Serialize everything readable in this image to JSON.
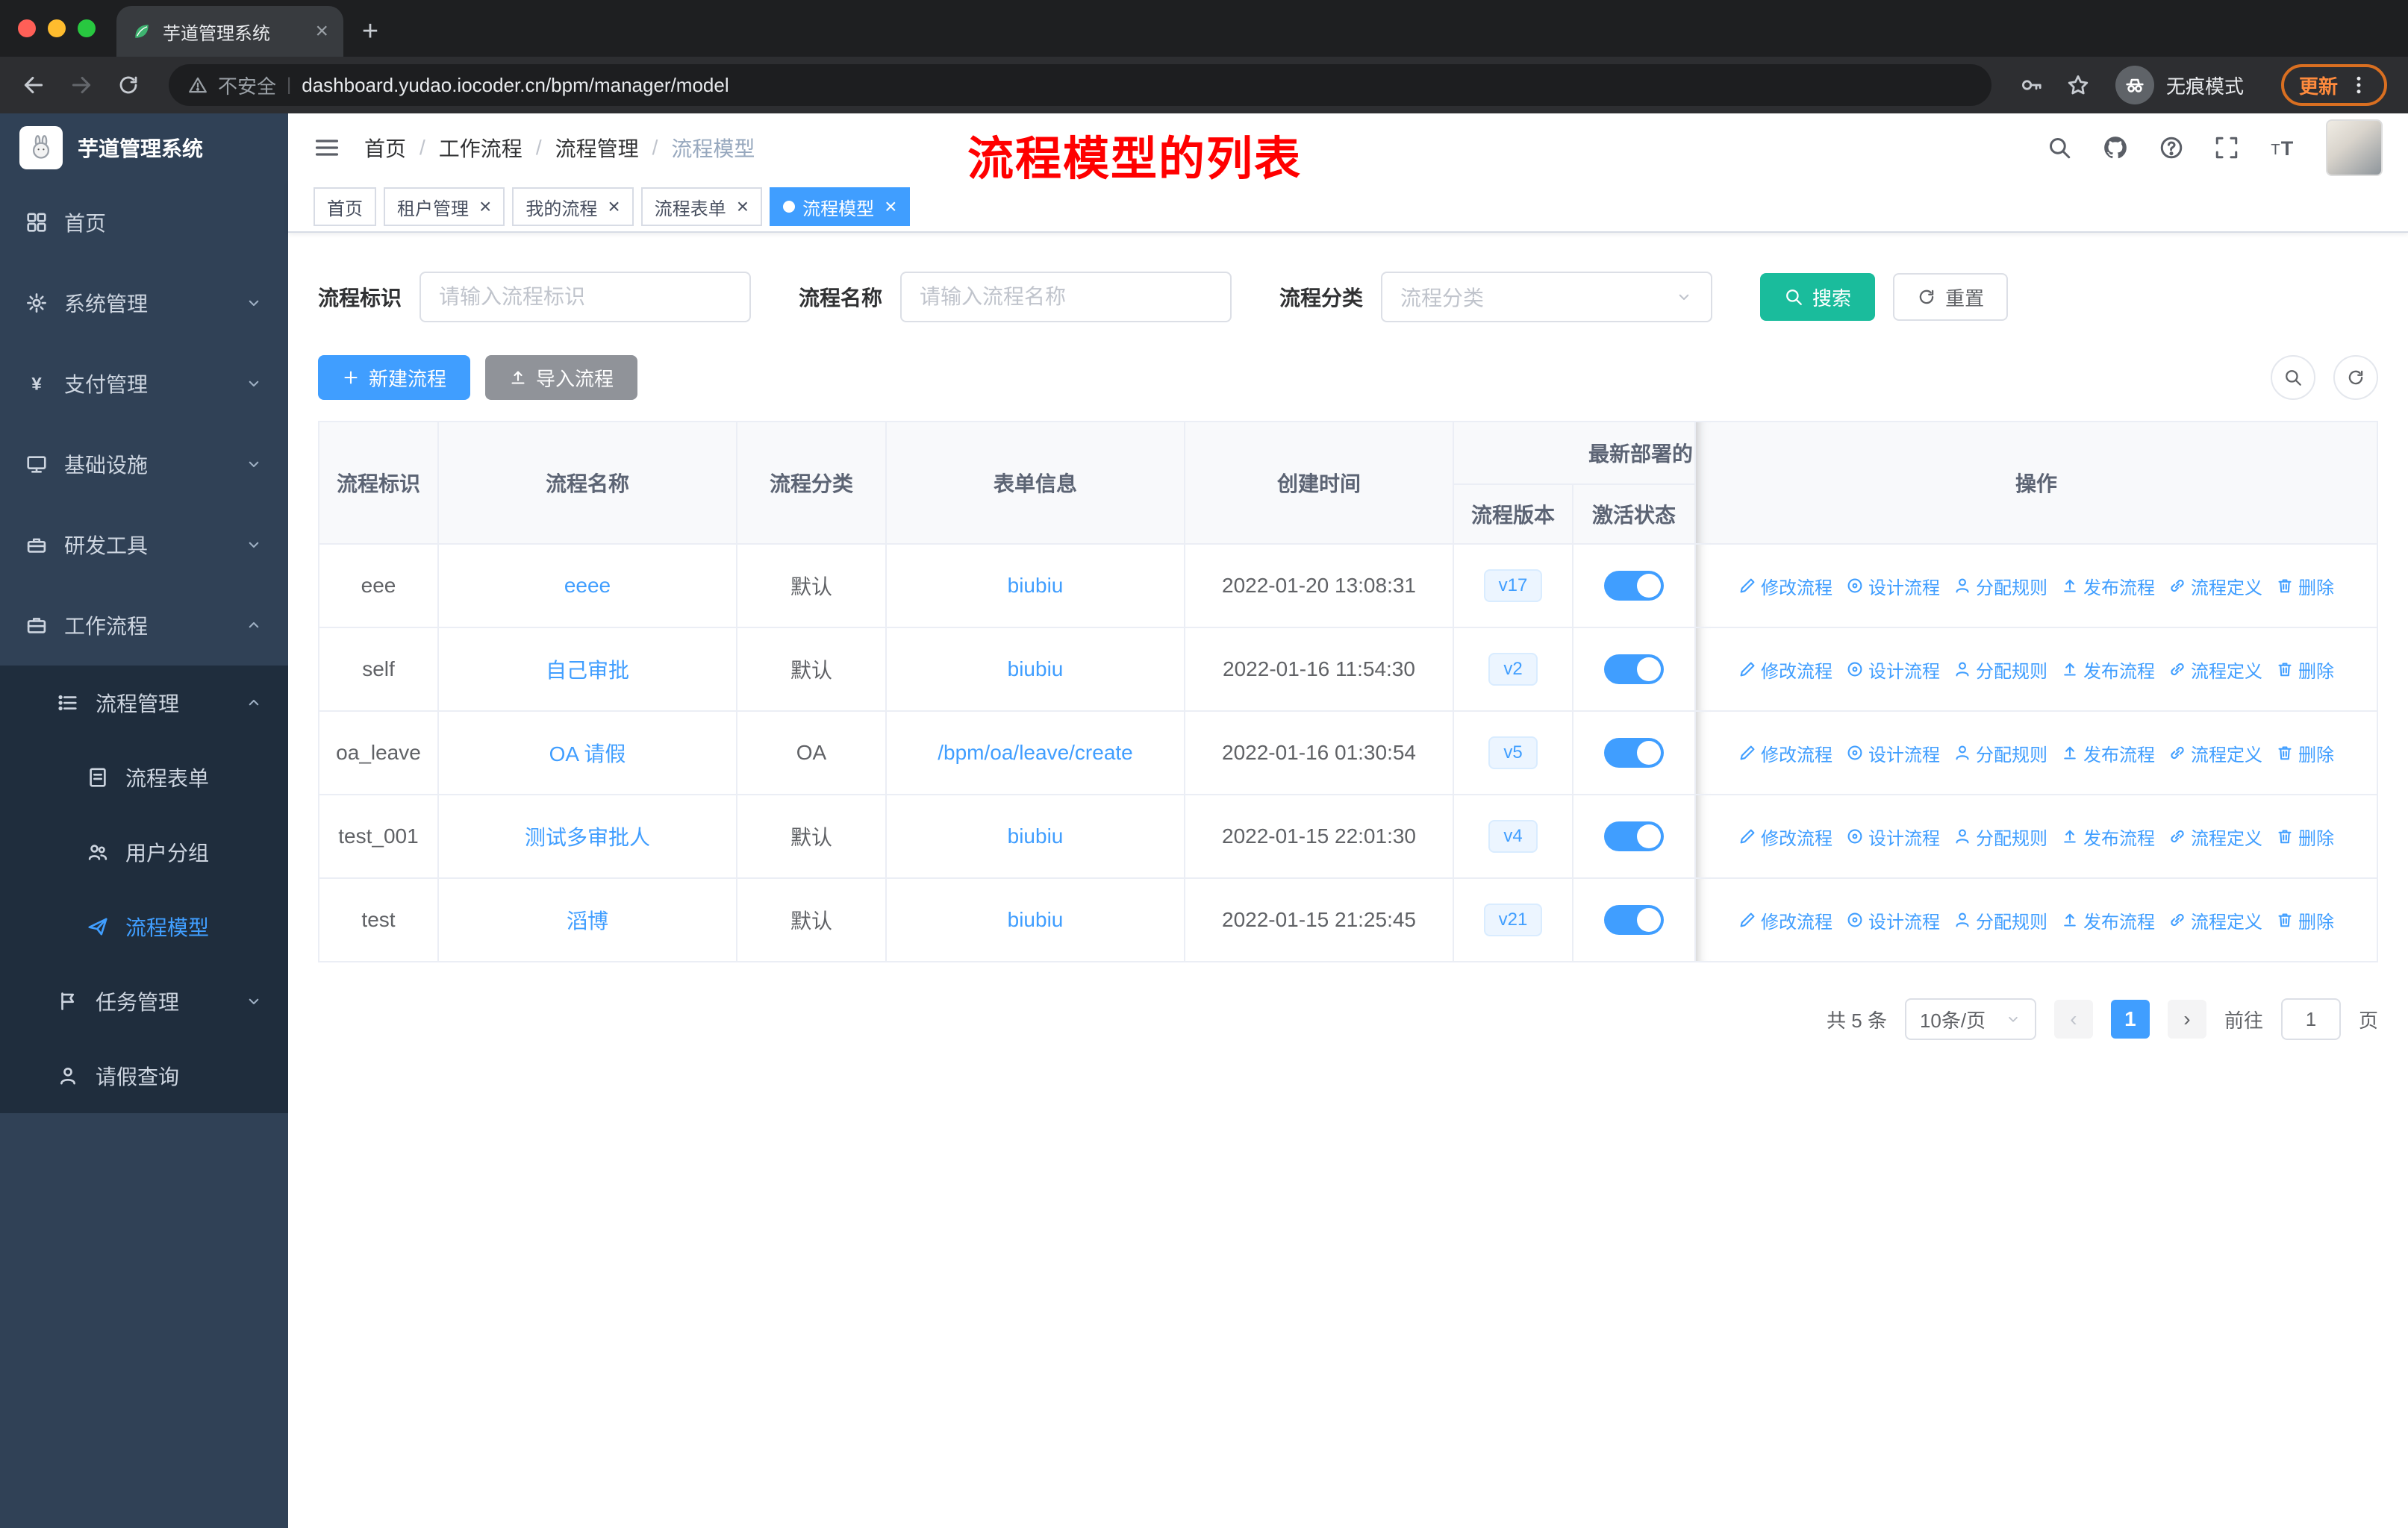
{
  "browser": {
    "tab_title": "芋道管理系统",
    "security_label": "不安全",
    "url": "dashboard.yudao.iocoder.cn/bpm/manager/model",
    "incognito_label": "无痕模式",
    "update_label": "更新"
  },
  "sidebar": {
    "logo_title": "芋道管理系统",
    "items": [
      {
        "key": "home",
        "label": "首页",
        "icon": "dashboard-icon",
        "level": 1
      },
      {
        "key": "system-manage",
        "label": "系统管理",
        "icon": "gear-icon",
        "level": 1,
        "chevron": "down"
      },
      {
        "key": "payment-manage",
        "label": "支付管理",
        "icon": "yen-icon",
        "level": 1,
        "chevron": "down"
      },
      {
        "key": "infrastructure",
        "label": "基础设施",
        "icon": "monitor-icon",
        "level": 1,
        "chevron": "down"
      },
      {
        "key": "dev-tools",
        "label": "研发工具",
        "icon": "toolbox-icon",
        "level": 1,
        "chevron": "down"
      },
      {
        "key": "workflow",
        "label": "工作流程",
        "icon": "briefcase-icon",
        "level": 1,
        "chevron": "up"
      },
      {
        "key": "process-manage",
        "label": "流程管理",
        "icon": "list-icon",
        "level": 2,
        "chevron": "up",
        "dark": true
      },
      {
        "key": "process-form",
        "label": "流程表单",
        "icon": "document-icon",
        "level": 3,
        "dark": true
      },
      {
        "key": "user-group",
        "label": "用户分组",
        "icon": "user-group-icon",
        "level": 3,
        "dark": true
      },
      {
        "key": "process-model",
        "label": "流程模型",
        "icon": "paper-plane-icon",
        "level": 3,
        "dark": true,
        "active": true
      },
      {
        "key": "task-manage",
        "label": "任务管理",
        "icon": "flag-icon",
        "level": 2,
        "chevron": "down",
        "dark": true
      },
      {
        "key": "leave-query",
        "label": "请假查询",
        "icon": "person-icon",
        "level": 2,
        "dark": true
      }
    ]
  },
  "header": {
    "breadcrumb": [
      "首页",
      "工作流程",
      "流程管理",
      "流程模型"
    ],
    "annotation": "流程模型的列表"
  },
  "tags": [
    {
      "key": "home",
      "label": "首页",
      "closable": false,
      "active": false
    },
    {
      "key": "tenant-manage",
      "label": "租户管理",
      "closable": true,
      "active": false
    },
    {
      "key": "my-process",
      "label": "我的流程",
      "closable": true,
      "active": false
    },
    {
      "key": "process-form",
      "label": "流程表单",
      "closable": true,
      "active": false
    },
    {
      "key": "process-model",
      "label": "流程模型",
      "closable": true,
      "active": true
    }
  ],
  "filters": {
    "fields": [
      {
        "label": "流程标识",
        "placeholder": "请输入流程标识"
      },
      {
        "label": "流程名称",
        "placeholder": "请输入流程名称"
      },
      {
        "label": "流程分类",
        "placeholder": "流程分类"
      }
    ],
    "search_label": "搜索",
    "reset_label": "重置"
  },
  "actions_bar": {
    "create_label": "新建流程",
    "import_label": "导入流程"
  },
  "table": {
    "columns": [
      "流程标识",
      "流程名称",
      "流程分类",
      "表单信息",
      "创建时间",
      "流程版本",
      "激活状态",
      "操作"
    ],
    "group_header": "最新部署的",
    "rows": [
      {
        "id": "eee",
        "name": "eeee",
        "category": "默认",
        "form": "biubiu",
        "created": "2022-01-20 13:08:31",
        "version": "v17",
        "active": true
      },
      {
        "id": "self",
        "name": "自己审批",
        "category": "默认",
        "form": "biubiu",
        "created": "2022-01-16 11:54:30",
        "version": "v2",
        "active": true
      },
      {
        "id": "oa_leave",
        "name": "OA 请假",
        "category": "OA",
        "form": "/bpm/oa/leave/create",
        "created": "2022-01-16 01:30:54",
        "version": "v5",
        "active": true
      },
      {
        "id": "test_001",
        "name": "测试多审批人",
        "category": "默认",
        "form": "biubiu",
        "created": "2022-01-15 22:01:30",
        "version": "v4",
        "active": true
      },
      {
        "id": "test",
        "name": "滔博",
        "category": "默认",
        "form": "biubiu",
        "created": "2022-01-15 21:25:45",
        "version": "v21",
        "active": true
      }
    ],
    "row_actions": [
      {
        "key": "modify-process",
        "label": "修改流程",
        "icon": "edit-icon"
      },
      {
        "key": "design-process",
        "label": "设计流程",
        "icon": "design-icon"
      },
      {
        "key": "assign-rule",
        "label": "分配规则",
        "icon": "user-icon"
      },
      {
        "key": "publish-process",
        "label": "发布流程",
        "icon": "publish-icon"
      },
      {
        "key": "process-definition",
        "label": "流程定义",
        "icon": "link-icon"
      },
      {
        "key": "delete",
        "label": "删除",
        "icon": "trash-icon"
      }
    ]
  },
  "pagination": {
    "total_label": "共 5 条",
    "page_size_label": "10条/页",
    "current_page": "1",
    "goto_label": "前往",
    "goto_value": "1",
    "page_suffix": "页"
  },
  "colors": {
    "accent_blue": "#409eff",
    "search_teal": "#1abc9c",
    "sidebar_bg": "#304156",
    "submenu_bg": "#1f2d3d",
    "annotation_red": "#ff0000",
    "update_orange": "#ff8b3d"
  }
}
